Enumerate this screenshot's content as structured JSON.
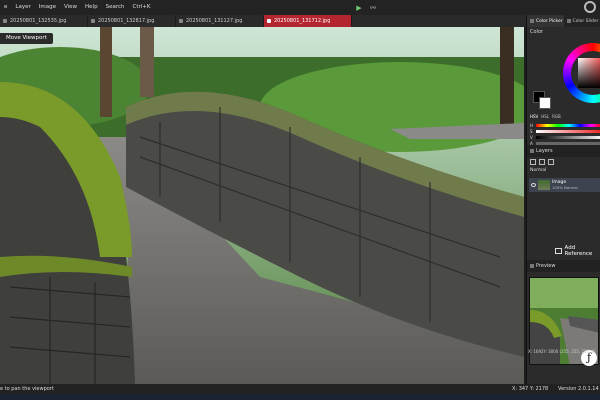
{
  "menu": {
    "items": [
      "e",
      "Layer",
      "Image",
      "View",
      "Help",
      "Search",
      "Ctrl+K"
    ]
  },
  "tabs": [
    {
      "label": "20250801_132535.jpg",
      "active": false
    },
    {
      "label": "20250801_132817.jpg",
      "active": false
    },
    {
      "label": "20250801_131127.jpg",
      "active": false
    },
    {
      "label": "20250801_131712.jpg",
      "active": true
    }
  ],
  "viewport": {
    "hint_badge": "Move Viewport"
  },
  "right_panel": {
    "tabs": [
      "Color Picker",
      "Color Slider"
    ],
    "color_label": "Color",
    "modes": [
      "HSV",
      "HSL",
      "RGB"
    ],
    "slider_labels": [
      "H",
      "S",
      "V",
      "A"
    ],
    "layers": {
      "title": "Layers",
      "blend_mode": "Normal",
      "layer_name": "Image",
      "layer_sub": "100% Normal"
    },
    "add_reference": "Add Reference",
    "preview_title": "Preview",
    "preview_status": "X: 1692Y: 3000   (255, 255, 255, 0)"
  },
  "status": {
    "hint": "e to pan the viewport",
    "coords": "X: 347 Y: 2178",
    "version": "Version 2.0.1.14"
  },
  "colors": {
    "accent_tab": "#b3262f",
    "play": "#6cc96c"
  }
}
